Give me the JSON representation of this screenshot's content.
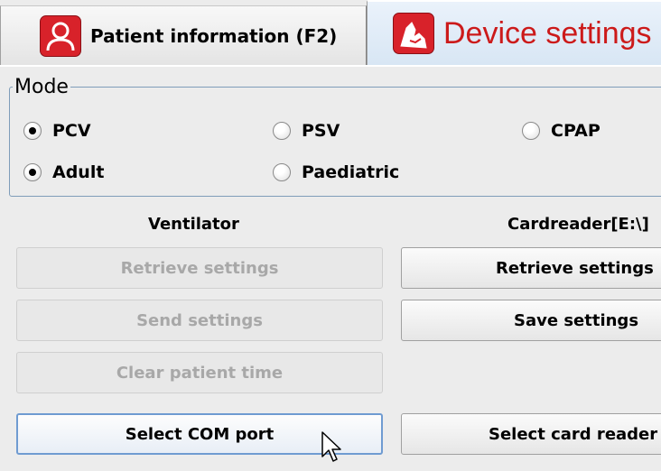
{
  "tabs": {
    "patient": {
      "label": "Patient information (F2)",
      "icon": "patient-icon"
    },
    "device": {
      "label": "Device settings",
      "icon": "device-icon",
      "active": true
    }
  },
  "mode": {
    "title": "Mode",
    "options_row1": [
      {
        "label": "PCV",
        "checked": true
      },
      {
        "label": "PSV",
        "checked": false
      },
      {
        "label": "CPAP",
        "checked": false
      }
    ],
    "options_row2": [
      {
        "label": "Adult",
        "checked": true
      },
      {
        "label": "Paediatric",
        "checked": false
      }
    ]
  },
  "ventilator": {
    "heading": "Ventilator",
    "retrieve_label": "Retrieve settings",
    "send_label": "Send settings",
    "clear_label": "Clear patient time",
    "com_port_label": "Select COM port"
  },
  "cardreader": {
    "heading": "Cardreader[E:\\]",
    "retrieve_label": "Retrieve settings",
    "save_label": "Save settings",
    "select_label": "Select card reader"
  },
  "colors": {
    "active_tab_text": "#cc1a1a",
    "icon_bg": "#d8222a",
    "focus_border": "#6f9bd1"
  }
}
